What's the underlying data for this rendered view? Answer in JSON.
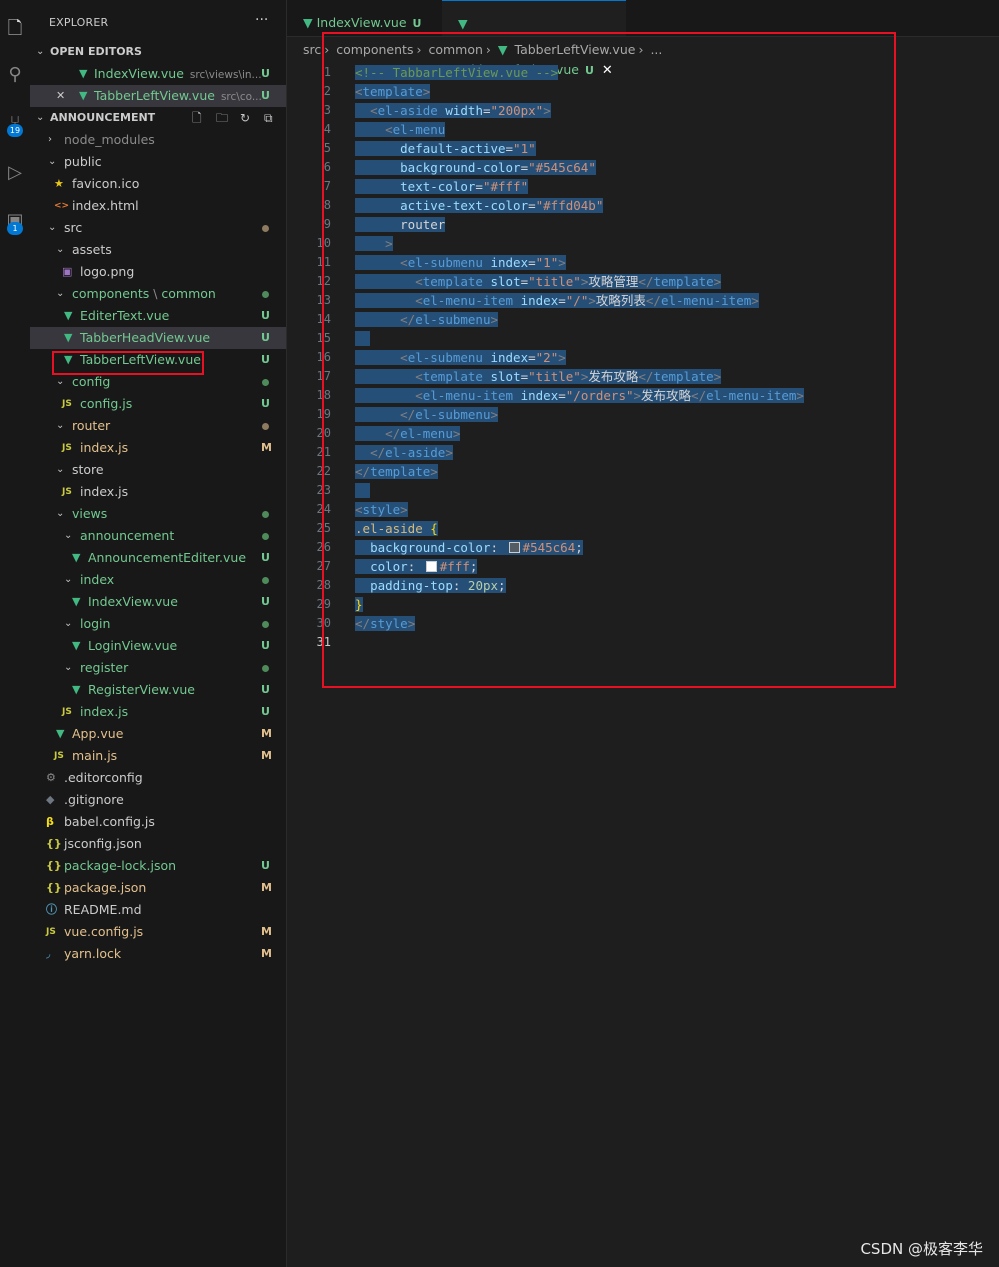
{
  "activity": {
    "source_control_badge": "19",
    "extensions_badge": "1"
  },
  "sidebar": {
    "title": "EXPLORER",
    "more": "···",
    "open_editors_label": "OPEN EDITORS",
    "open_editors": [
      {
        "name": "IndexView.vue",
        "path": "src\\views\\in...",
        "status": "U"
      },
      {
        "name": "TabberLeftView.vue",
        "path": "src\\co...",
        "status": "U"
      }
    ],
    "project_label": "ANNOUNCEMENT",
    "tree": [
      {
        "label": "node_modules"
      },
      {
        "label": "public"
      },
      {
        "label": "favicon.ico"
      },
      {
        "label": "index.html"
      },
      {
        "label": "src"
      },
      {
        "label": "assets"
      },
      {
        "label": "logo.png"
      },
      {
        "label": "components",
        "label2": "common"
      },
      {
        "label": "EditerText.vue",
        "status": "U"
      },
      {
        "label": "TabberHeadView.vue",
        "status": "U"
      },
      {
        "label": "TabberLeftView.vue",
        "status": "U"
      },
      {
        "label": "config"
      },
      {
        "label": "config.js",
        "status": "U"
      },
      {
        "label": "router"
      },
      {
        "label": "index.js",
        "status": "M"
      },
      {
        "label": "store"
      },
      {
        "label": "index.js"
      },
      {
        "label": "views"
      },
      {
        "label": "announcement"
      },
      {
        "label": "AnnouncementEditer.vue",
        "status": "U"
      },
      {
        "label": "index"
      },
      {
        "label": "IndexView.vue",
        "status": "U"
      },
      {
        "label": "login"
      },
      {
        "label": "LoginView.vue",
        "status": "U"
      },
      {
        "label": "register"
      },
      {
        "label": "RegisterView.vue",
        "status": "U"
      },
      {
        "label": "index.js",
        "status": "U"
      },
      {
        "label": "App.vue",
        "status": "M"
      },
      {
        "label": "main.js",
        "status": "M"
      },
      {
        "label": ".editorconfig"
      },
      {
        "label": ".gitignore"
      },
      {
        "label": "babel.config.js"
      },
      {
        "label": "jsconfig.json"
      },
      {
        "label": "package-lock.json",
        "status": "U"
      },
      {
        "label": "package.json",
        "status": "M"
      },
      {
        "label": "README.md"
      },
      {
        "label": "vue.config.js",
        "status": "M"
      },
      {
        "label": "yarn.lock",
        "status": "M"
      }
    ],
    "icons": {
      "js": "JS",
      "json": "{}",
      "html": "<>"
    }
  },
  "tabs": [
    {
      "name": "IndexView.vue",
      "status": "U"
    },
    {
      "name": "TabberLeftView.vue",
      "status": "U",
      "close": "✕"
    }
  ],
  "breadcrumb": [
    "src",
    "components",
    "common",
    "TabberLeftView.vue",
    "..."
  ],
  "code_lines": [
    "<!-- TabbarLeftView.vue -->",
    "<template>",
    "  <el-aside width=\"200px\">",
    "    <el-menu",
    "      default-active=\"1\"",
    "      background-color=\"#545c64\"",
    "      text-color=\"#fff\"",
    "      active-text-color=\"#ffd04b\"",
    "      router",
    "    >",
    "      <el-submenu index=\"1\">",
    "        <template slot=\"title\">攻略管理</template>",
    "        <el-menu-item index=\"/\">攻略列表</el-menu-item>",
    "      </el-submenu>",
    "",
    "      <el-submenu index=\"2\">",
    "        <template slot=\"title\">发布攻略</template>",
    "        <el-menu-item index=\"/orders\">发布攻略</el-menu-item>",
    "      </el-submenu>",
    "    </el-menu>",
    "  </el-aside>",
    "</template>",
    "",
    "<style>",
    ".el-aside {",
    "  background-color: #545c64;",
    "  color: #fff;",
    "  padding-top: 20px;",
    "}",
    "</style>",
    ""
  ],
  "watermark": "CSDN @极客李华",
  "colors": {
    "vue": "#42b883",
    "untracked": "#73c991",
    "modified": "#e2c08d",
    "selection": "#264f78",
    "highlight_box": "#e81123"
  }
}
